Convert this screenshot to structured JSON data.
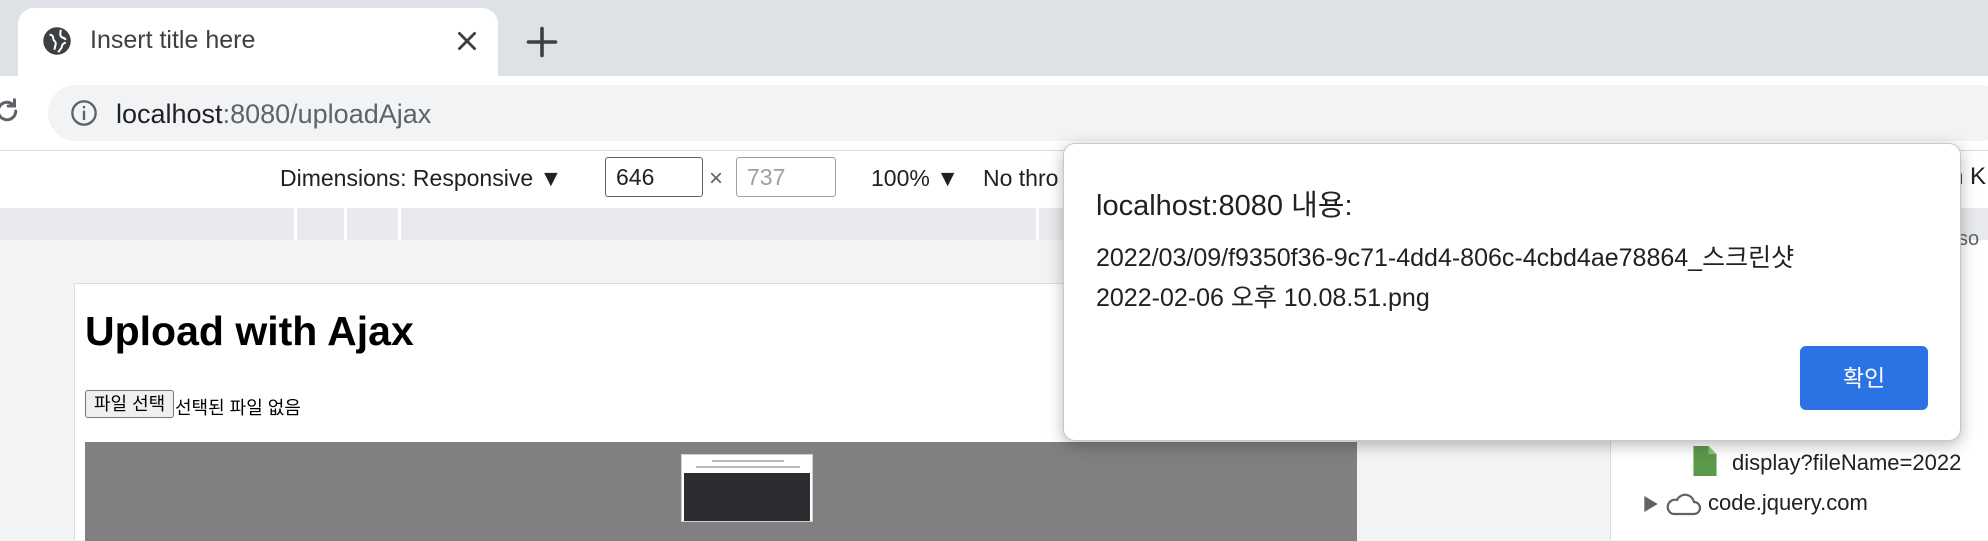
{
  "browser": {
    "tab_title": "Insert title here",
    "url_host": "localhost",
    "url_rest": ":8080/uploadAjax"
  },
  "device_toolbar": {
    "dimensions_label": "Dimensions: Responsive ▼",
    "width_value": "646",
    "height_placeholder": "737",
    "times": "×",
    "zoom_label": "100% ▼",
    "throttle_label": "No thro"
  },
  "page": {
    "heading": "Upload with Ajax",
    "file_button": "파일 선택",
    "file_status": "선택된 파일 없음"
  },
  "devtools": {
    "tree_file_label": "display?fileName=2022",
    "tree_cloud_label": "code.jquery.com",
    "peek_right_top": "n K",
    "peek_right_mid": "so"
  },
  "dialog": {
    "title": "localhost:8080 내용:",
    "message_line1": "2022/03/09/f9350f36-9c71-4dd4-806c-4cbd4ae78864_스크린샷",
    "message_line2": "2022-02-06 오후 10.08.51.png",
    "ok_label": "확인"
  },
  "colors": {
    "accent": "#2b72e4",
    "tab_strip": "#dee1e6",
    "file_icon": "#5a9a4a"
  }
}
